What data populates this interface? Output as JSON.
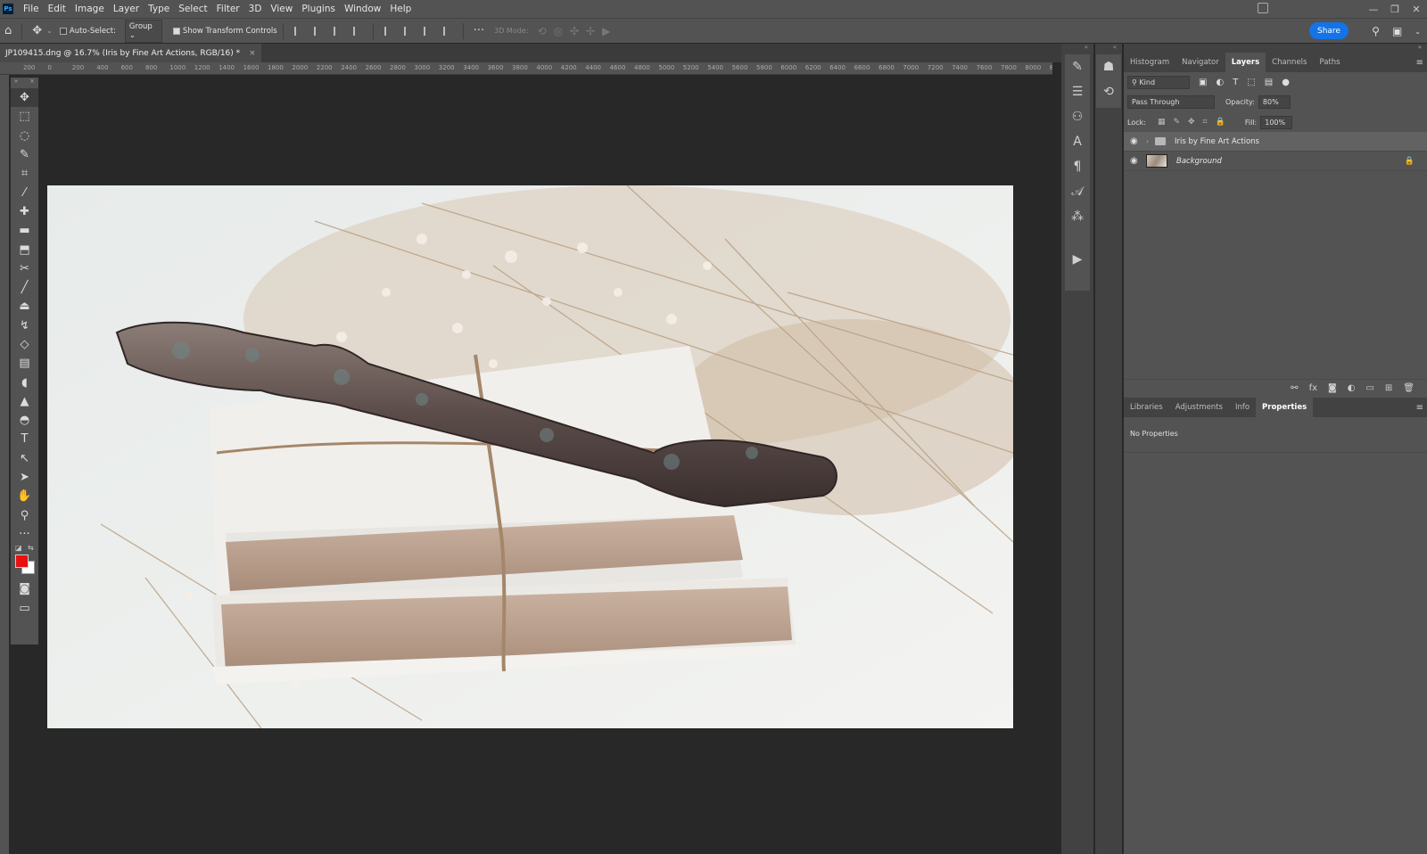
{
  "app": {
    "logo": "Ps"
  },
  "menu": [
    "File",
    "Edit",
    "Image",
    "Layer",
    "Type",
    "Select",
    "Filter",
    "3D",
    "View",
    "Plugins",
    "Window",
    "Help"
  ],
  "window_controls": [
    "—",
    "❐",
    "✕"
  ],
  "options_bar": {
    "auto_select_label": "Auto-Select:",
    "auto_select_value": "Group",
    "show_transform_label": "Show Transform Controls",
    "mode_3d_label": "3D Mode:",
    "share_label": "Share"
  },
  "document": {
    "tab_title": "JP109415.dng @ 16.7% (Iris by Fine Art Actions, RGB/16) *",
    "close_glyph": "×"
  },
  "ruler": [
    "200",
    "0",
    "200",
    "400",
    "600",
    "800",
    "1000",
    "1200",
    "1400",
    "1600",
    "1800",
    "2000",
    "2200",
    "2400",
    "2600",
    "2800",
    "3000",
    "3200",
    "3400",
    "3600",
    "3800",
    "4000",
    "4200",
    "4400",
    "4600",
    "4800",
    "5000",
    "5200",
    "5400",
    "5600",
    "5800",
    "6000",
    "6200",
    "6400",
    "6600",
    "6800",
    "7000",
    "7200",
    "7400",
    "7600",
    "7800",
    "8000",
    "8"
  ],
  "tools": [
    {
      "name": "move-tool",
      "glyph": "✥"
    },
    {
      "name": "marquee-tool",
      "glyph": "⬚"
    },
    {
      "name": "lasso-tool",
      "glyph": "◌"
    },
    {
      "name": "quick-select-tool",
      "glyph": "✎"
    },
    {
      "name": "crop-tool",
      "glyph": "⌗"
    },
    {
      "name": "eyedropper-tool",
      "glyph": "⁄"
    },
    {
      "name": "healing-tool",
      "glyph": "✚"
    },
    {
      "name": "patch-tool",
      "glyph": "▬"
    },
    {
      "name": "content-aware-tool",
      "glyph": "⬒"
    },
    {
      "name": "scissors-tool",
      "glyph": "✂"
    },
    {
      "name": "brush-tool",
      "glyph": "╱"
    },
    {
      "name": "stamp-tool",
      "glyph": "⏏"
    },
    {
      "name": "history-brush-tool",
      "glyph": "↯"
    },
    {
      "name": "eraser-tool",
      "glyph": "◇"
    },
    {
      "name": "gradient-tool",
      "glyph": "▤"
    },
    {
      "name": "blur-tool",
      "glyph": "◖"
    },
    {
      "name": "sharpen-tool",
      "glyph": "▲"
    },
    {
      "name": "dodge-tool",
      "glyph": "◓"
    },
    {
      "name": "type-tool",
      "glyph": "T"
    },
    {
      "name": "path-select-tool",
      "glyph": "↖"
    },
    {
      "name": "direct-select-tool",
      "glyph": "➤"
    },
    {
      "name": "hand-tool",
      "glyph": "✋"
    },
    {
      "name": "zoom-tool",
      "glyph": "⚲"
    },
    {
      "name": "more-tools",
      "glyph": "···"
    }
  ],
  "colors": {
    "foreground": "#e81010",
    "background": "#ffffff",
    "accent": "#1473e6"
  },
  "panel_tabs_top": [
    "Histogram",
    "Navigator",
    "Layers",
    "Channels",
    "Paths"
  ],
  "panel_tabs_top_active": "Layers",
  "layers_panel": {
    "filter_kind": "Kind",
    "blend_mode": "Pass Through",
    "opacity_label": "Opacity:",
    "opacity_value": "80%",
    "lock_label": "Lock:",
    "fill_label": "Fill:",
    "fill_value": "100%",
    "layers": [
      {
        "name": "Iris by Fine Art Actions",
        "type": "group",
        "visible": true,
        "selected": true
      },
      {
        "name": "Background",
        "type": "image",
        "visible": true,
        "locked": true
      }
    ],
    "footer_icons": [
      "link-icon",
      "fx-icon",
      "mask-icon",
      "adjustment-icon",
      "folder-icon",
      "new-layer-icon",
      "trash-icon"
    ],
    "footer_glyphs": [
      "⚯",
      "fx",
      "◙",
      "◐",
      "▭",
      "⊞",
      "🗑"
    ]
  },
  "panel_tabs_bottom": [
    "Libraries",
    "Adjustments",
    "Info",
    "Properties"
  ],
  "panel_tabs_bottom_active": "Properties",
  "properties": {
    "text": "No Properties"
  }
}
